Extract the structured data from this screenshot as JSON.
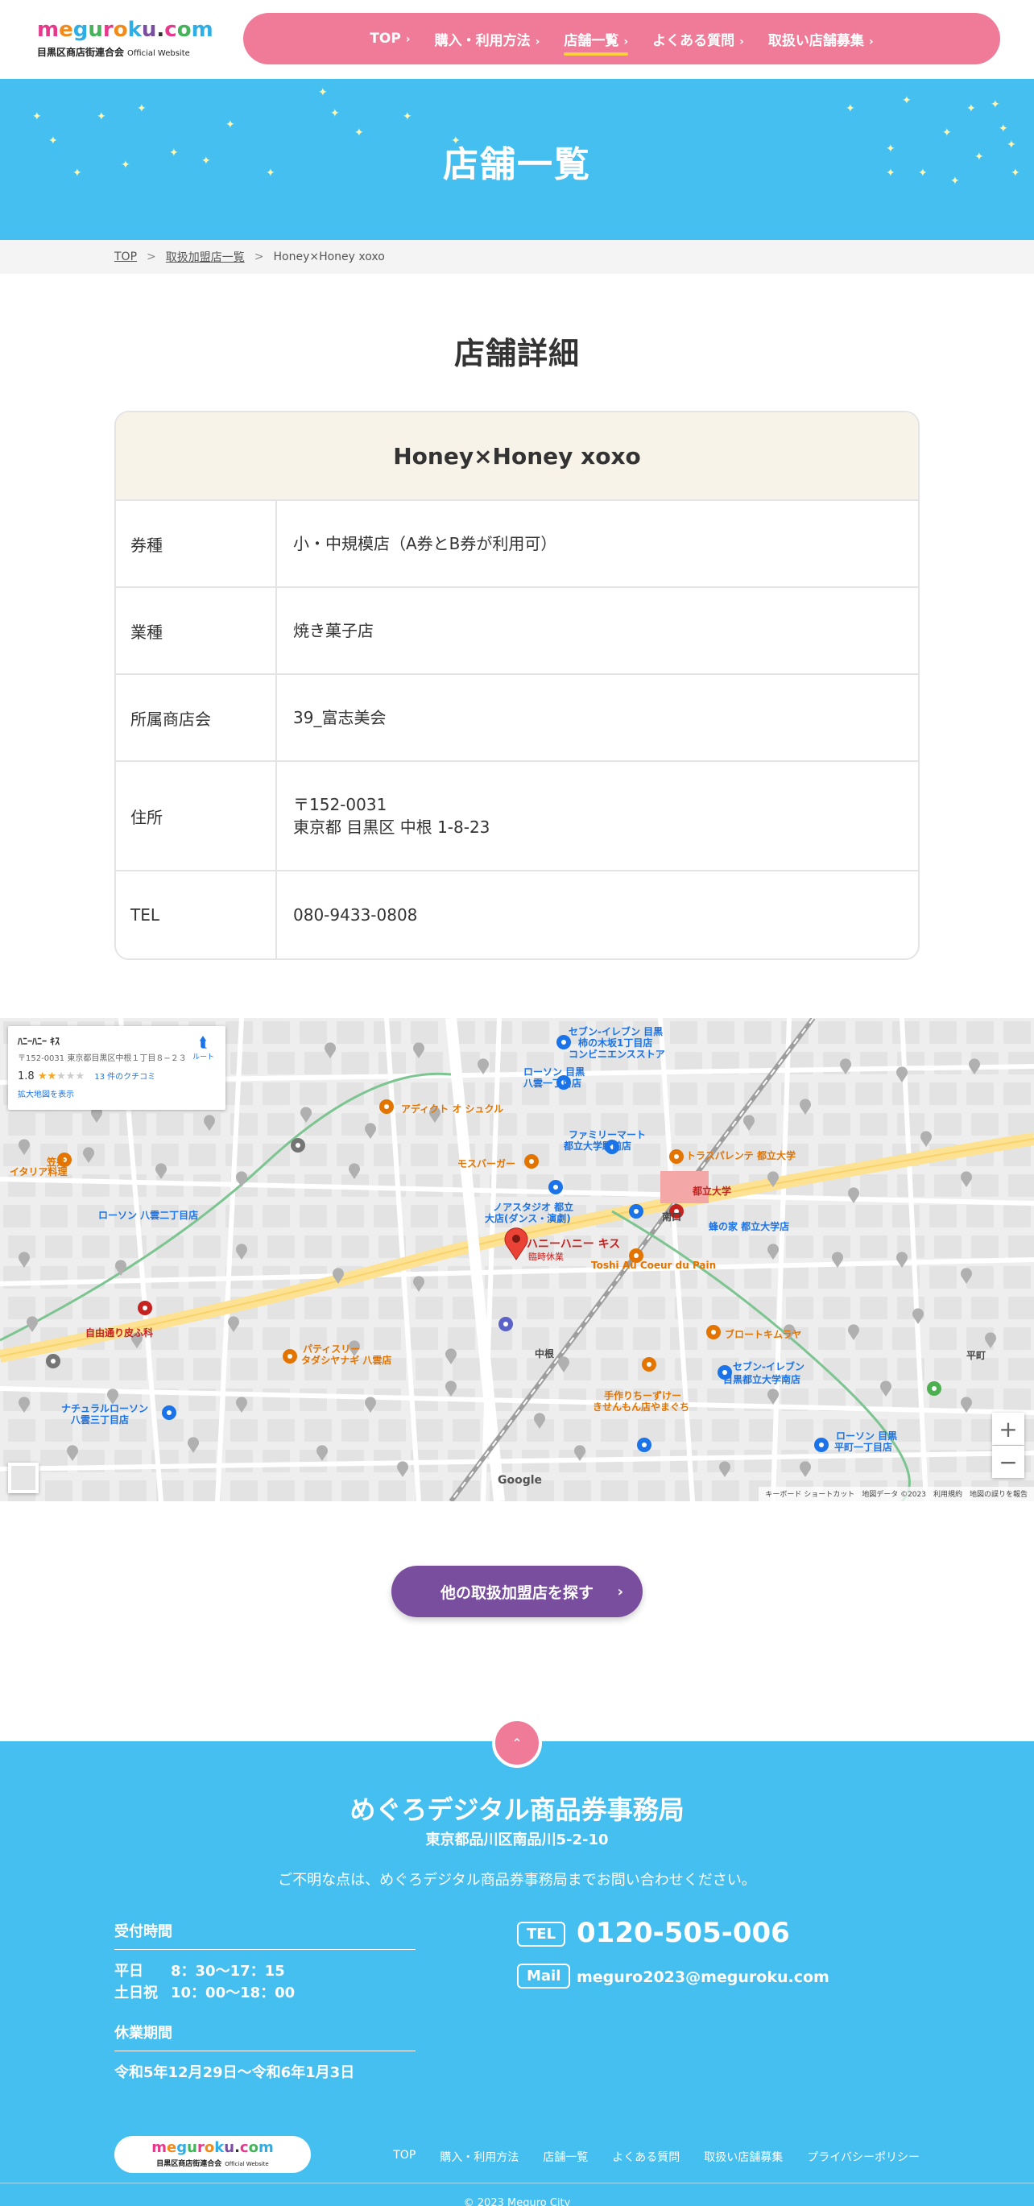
{
  "brand": {
    "logo_letters": [
      "m",
      "e",
      "g",
      "u",
      "r",
      "o",
      "k",
      "u",
      ".",
      "c",
      "o",
      "m"
    ],
    "logo_colors": [
      "#e6398b",
      "#f18a1b",
      "#2eaee6",
      "#44b35a",
      "#e6398b",
      "#f18a1b",
      "#2eaee6",
      "#7a4e9e",
      "#333333",
      "#e6398b",
      "#44b35a",
      "#2eaee6"
    ],
    "association": "目黒区商店街連合会",
    "official": "Official Website"
  },
  "nav": {
    "items": [
      {
        "label": "TOP"
      },
      {
        "label": "購入・利用方法"
      },
      {
        "label": "店舗一覧"
      },
      {
        "label": "よくある質問"
      },
      {
        "label": "取扱い店舗募集"
      }
    ],
    "active_index": 2
  },
  "hero": {
    "title": "店舗一覧"
  },
  "breadcrumb": {
    "items": [
      "TOP",
      "取扱加盟店一覧",
      "Honey×Honey xoxo"
    ],
    "separator": ">"
  },
  "detail": {
    "section_title": "店舗詳細",
    "store_name": "Honey×Honey xoxo",
    "rows": [
      {
        "label": "券種",
        "values": [
          "小・中規模店（A券とB券が利用可）"
        ]
      },
      {
        "label": "業種",
        "values": [
          "焼き菓子店"
        ]
      },
      {
        "label": "所属商店会",
        "values": [
          "39_富志美会"
        ]
      },
      {
        "label": "住所",
        "values": [
          "〒152-0031",
          "東京都 目黒区 中根 1-8-23"
        ]
      },
      {
        "label": "TEL",
        "values": [
          "080-9433-0808"
        ]
      }
    ]
  },
  "map": {
    "card_title": "ﾊﾆｰﾊﾆｰ ｷｽ",
    "card_address": "〒152-0031 東京都目黒区中根１丁目８−２３",
    "rating": "1.8",
    "reviews": "13 件のクチコミ",
    "larger_map": "拡大地図を表示",
    "directions": "ルート",
    "pin_name": "ハニーハニー キス",
    "pin_status": "臨時休業",
    "google": "Google",
    "attribution": "キーボード ショートカット　地図データ ©2023　利用規約　地図の誤りを報告",
    "labels": [
      {
        "text": "セブン-イレブン 目黒",
        "color": "#1a73e8"
      },
      {
        "text": "柿の木坂1丁目店",
        "color": "#1a73e8"
      },
      {
        "text": "コンビニエンスストア",
        "color": "#1a73e8"
      },
      {
        "text": "アディクト オ シュクル",
        "color": "#e37400"
      },
      {
        "text": "ローソン 目黒",
        "color": "#1a73e8"
      },
      {
        "text": "八雲一丁目店",
        "color": "#1a73e8"
      },
      {
        "text": "モスバーガー",
        "color": "#e37400"
      },
      {
        "text": "ファミリーマート",
        "color": "#1a73e8"
      },
      {
        "text": "都立大学駅前店",
        "color": "#1a73e8"
      },
      {
        "text": "トラスパレンテ 都立大学",
        "color": "#e37400"
      },
      {
        "text": "都立大学",
        "color": "#c5221f"
      },
      {
        "text": "ローソン 八雲二丁目店",
        "color": "#1a73e8"
      },
      {
        "text": "ノアスタジオ 都立",
        "color": "#1a73e8"
      },
      {
        "text": "大店(ダンス・演劇)",
        "color": "#1a73e8"
      },
      {
        "text": "蜂の家 都立大学店",
        "color": "#1a73e8"
      },
      {
        "text": "Toshi Au Coeur du Pain",
        "color": "#e37400"
      },
      {
        "text": "自由通り皮ふ科",
        "color": "#c5221f"
      },
      {
        "text": "パティスリー",
        "color": "#e37400"
      },
      {
        "text": "タダシヤナギ 八雲店",
        "color": "#e37400"
      },
      {
        "text": "ブロートキムラヤ",
        "color": "#e37400"
      },
      {
        "text": "セブン-イレブン",
        "color": "#1a73e8"
      },
      {
        "text": "目黒都立大学南店",
        "color": "#1a73e8"
      },
      {
        "text": "手作りちーずけー",
        "color": "#e37400"
      },
      {
        "text": "きせんもん店やまぐち",
        "color": "#e37400"
      },
      {
        "text": "ナチュラルローソン",
        "color": "#1a73e8"
      },
      {
        "text": "八雲三丁目店",
        "color": "#1a73e8"
      },
      {
        "text": "ローソン 目黒",
        "color": "#1a73e8"
      },
      {
        "text": "平町一丁目店",
        "color": "#1a73e8"
      },
      {
        "text": "中根",
        "color": "#444444"
      },
      {
        "text": "平町",
        "color": "#444444"
      },
      {
        "text": "笠井",
        "color": "#e37400"
      },
      {
        "text": "イタリア料理",
        "color": "#e37400"
      },
      {
        "text": "南口",
        "color": "#444444"
      }
    ]
  },
  "cta": {
    "label": "他の取扱加盟店を探す"
  },
  "footer": {
    "title": "めぐろデジタル商品券事務局",
    "address": "東京都品川区南品川5-2-10",
    "note": "ご不明な点は、めぐろデジタル商品券事務局までお問い合わせください。",
    "hours_label": "受付時間",
    "hours": [
      {
        "day": "平日",
        "time": "8：30〜17：15"
      },
      {
        "day": "土日祝",
        "time": "10：00〜18：00"
      }
    ],
    "closed_label": "休業期間",
    "closed": "令和5年12月29日〜令和6年1月3日",
    "tel_badge": "TEL",
    "tel": "0120-505-006",
    "mail_badge": "Mail",
    "mail": "meguro2023@meguroku.com",
    "links": [
      "TOP",
      "購入・利用方法",
      "店舗一覧",
      "よくある質問",
      "取扱い店舗募集",
      "プライバシーポリシー"
    ],
    "copyright": "© 2023 Meguro City"
  }
}
